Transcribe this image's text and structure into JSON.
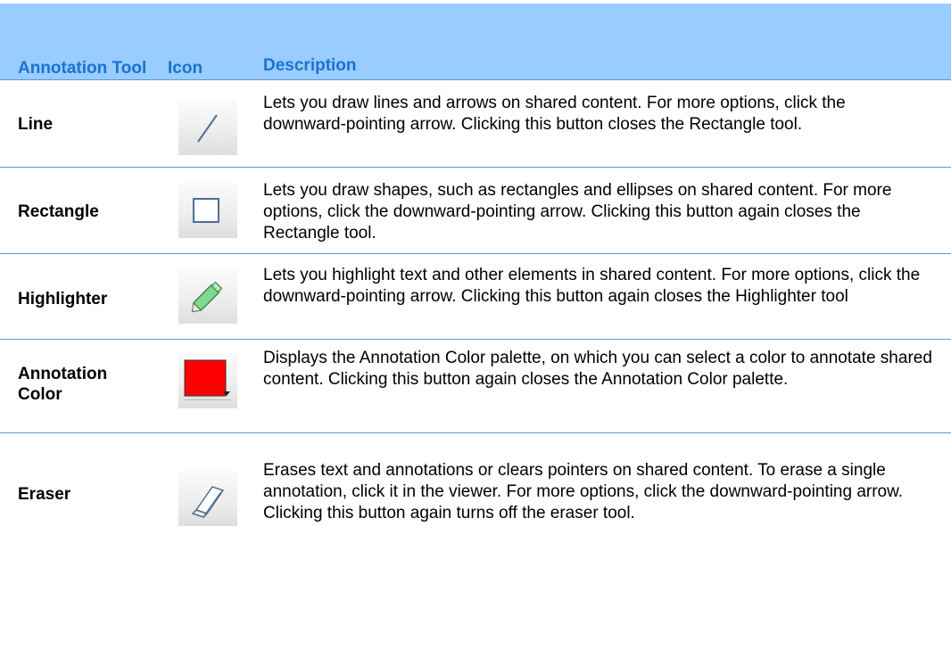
{
  "header": {
    "tool": "Annotation Tool",
    "icon": "Icon",
    "description": "Description"
  },
  "rows": [
    {
      "tool": "Line",
      "icon": "line-tool-icon",
      "description": "Lets you draw lines and arrows on shared content. For more options, click the downward-pointing arrow. Clicking this button closes the Rectangle tool."
    },
    {
      "tool": "Rectangle",
      "icon": "rectangle-tool-icon",
      "description": "Lets you draw shapes, such as rectangles and ellipses on shared content. For more options, click the downward-pointing arrow. Clicking this button again closes the Rectangle tool."
    },
    {
      "tool": "Highlighter",
      "icon": "highlighter-tool-icon",
      "description": "Lets you highlight text and other elements in shared content. For more options, click the downward-pointing arrow. Clicking this button again closes the Highlighter tool"
    },
    {
      "tool": "Annotation Color",
      "icon": "annotation-color-icon",
      "description": "Displays the Annotation Color palette, on which you can select a color to annotate shared content. Clicking this button again closes the Annotation Color palette."
    },
    {
      "tool": "Eraser",
      "icon": "eraser-tool-icon",
      "description": "Erases text and annotations or clears pointers on shared content. To erase a single annotation, click it in the viewer. For more options, click the downward-pointing arrow. Clicking this button again turns off the eraser tool."
    }
  ],
  "colors": {
    "header_background": "#99ccff",
    "header_text": "#1a73d0",
    "row_divider": "#5a9ad6",
    "annotation_color_swatch": "#ff0000"
  }
}
